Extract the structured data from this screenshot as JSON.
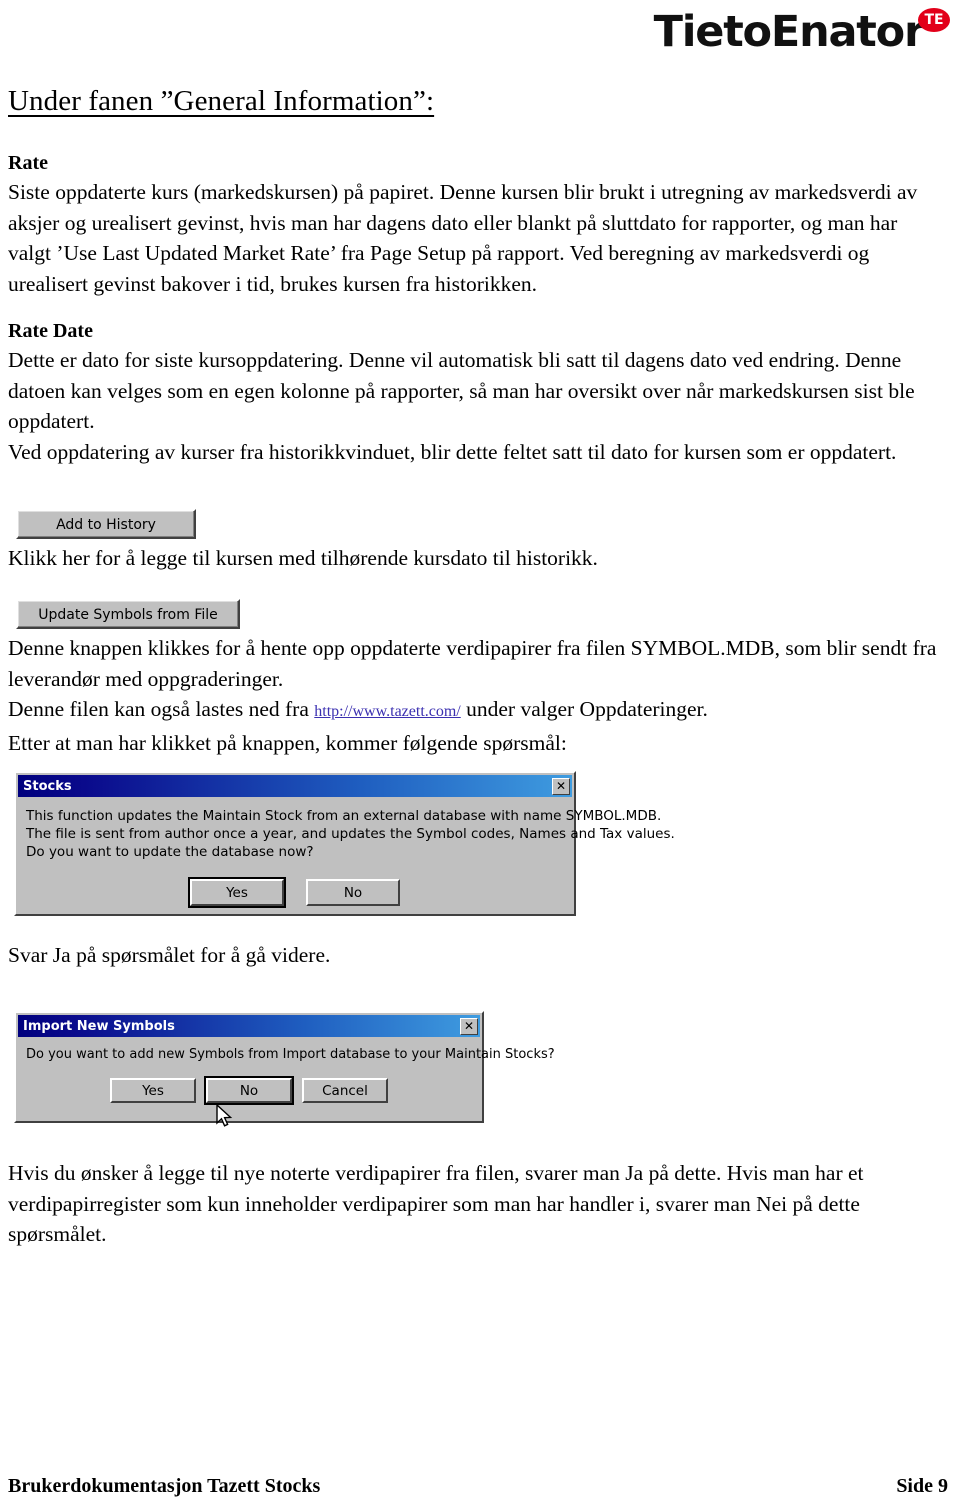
{
  "brand": {
    "logo_text": "TietoEnator",
    "logo_badge": "TE",
    "badge_color": "#e2001a"
  },
  "heading": "Under fanen ”General Information”:",
  "sections": [
    {
      "title": "Rate",
      "paragraph": "Siste oppdaterte kurs (markedskursen) på papiret. Denne kursen blir brukt i utregning av markedsverdi av aksjer og urealisert gevinst, hvis man har dagens dato eller blankt på sluttdato for rapporter, og man har valgt ’Use Last Updated Market Rate’ fra Page Setup på rapport. Ved beregning av markedsverdi og urealisert gevinst bakover i tid, brukes kursen fra historikken."
    },
    {
      "title": "Rate Date",
      "paragraph_1": "Dette er dato for siste kursoppdatering. Denne vil automatisk bli satt til dagens dato ved endring. Denne datoen kan velges som en egen kolonne på rapporter, så man har oversikt over når markedskursen sist ble oppdatert.",
      "paragraph_2": "Ved oppdatering av kurser fra historikkvinduet, blir dette feltet satt til dato for kursen som er oppdatert."
    }
  ],
  "buttons": {
    "add_to_history": "Add to History",
    "update_symbols_from_file": "Update Symbols from File"
  },
  "captions": {
    "add_to_history_text": "Klikk her for å legge til kursen med tilhørende kursdato til historikk.",
    "update_symbols_text_1": "Denne knappen klikkes for å hente opp oppdaterte verdipapirer fra filen SYMBOL.MDB, som blir sendt fra leverandør med oppgraderinger.",
    "update_symbols_text_2_pre": "Denne filen kan også lastes ned fra ",
    "update_symbols_link": "http://www.tazett.com/",
    "update_symbols_text_2_post": " under valger Oppdateringer.",
    "update_symbols_text_3": "Etter at man har klikket på knappen, kommer følgende spørsmål:",
    "answer_yes_text": "Svar Ja på spørsmålet for å gå videre.",
    "final_text": "Hvis du ønsker å legge til nye noterte verdipapirer fra filen, svarer man Ja på dette. Hvis man har et verdipapirregister som kun inneholder verdipapirer som man har handler i, svarer man Nei på dette spørsmålet."
  },
  "dialogs": {
    "stocks": {
      "title": "Stocks",
      "close_label": "✕",
      "message_line_1": "This function updates the Maintain Stock from an external database with name SYMBOL.MDB.",
      "message_line_2": "The file is sent from author once a year, and updates the Symbol codes, Names and Tax values.",
      "message_line_3": "Do you want to update the database now?",
      "button_yes": "Yes",
      "button_no": "No"
    },
    "import_new_symbols": {
      "title": "Import New Symbols",
      "close_label": "✕",
      "message_line_1": "Do you want to add new Symbols from Import database to your Maintain Stocks?",
      "button_yes": "Yes",
      "button_no": "No",
      "button_cancel": "Cancel"
    }
  },
  "footer": {
    "left": "Brukerdokumentasjon Tazett Stocks",
    "right": "Side 9"
  }
}
